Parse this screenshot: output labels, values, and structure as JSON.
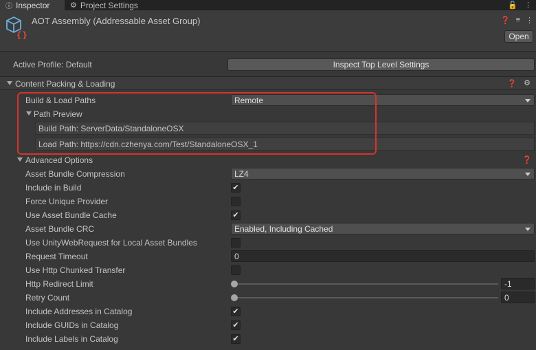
{
  "tabs": [
    {
      "label": "Inspector",
      "icon": "info-icon",
      "active": true
    },
    {
      "label": "Project Settings",
      "icon": "gear-icon",
      "active": false
    }
  ],
  "header": {
    "title": "AOT Assembly (Addressable Asset Group)",
    "open_label": "Open"
  },
  "profile": {
    "label": "Active Profile: Default",
    "button_label": "Inspect Top Level Settings"
  },
  "content_section": {
    "title": "Content Packing & Loading"
  },
  "build_load_paths": {
    "label": "Build & Load Paths",
    "value": "Remote",
    "preview_title": "Path Preview",
    "build_path": "Build Path: ServerData/StandaloneOSX",
    "load_path": "Load Path: https://cdn.czhenya.com/Test/StandaloneOSX_1"
  },
  "advanced": {
    "title": "Advanced Options",
    "rows": {
      "compression": {
        "label": "Asset Bundle Compression",
        "value": "LZ4"
      },
      "include_in_build": {
        "label": "Include in Build",
        "checked": true
      },
      "force_unique": {
        "label": "Force Unique Provider",
        "checked": false
      },
      "bundle_cache": {
        "label": "Use Asset Bundle Cache",
        "checked": true
      },
      "bundle_crc": {
        "label": "Asset Bundle CRC",
        "value": "Enabled, Including Cached"
      },
      "uwr_local": {
        "label": "Use UnityWebRequest for Local Asset Bundles",
        "checked": false
      },
      "request_timeout": {
        "label": "Request Timeout",
        "value": "0"
      },
      "http_chunked": {
        "label": "Use Http Chunked Transfer",
        "checked": false
      },
      "redirect_limit": {
        "label": "Http Redirect Limit",
        "value": "-1"
      },
      "retry_count": {
        "label": "Retry Count",
        "value": "0"
      },
      "include_addresses": {
        "label": "Include Addresses in Catalog",
        "checked": true
      },
      "include_guids": {
        "label": "Include GUIDs in Catalog",
        "checked": true
      },
      "include_labels": {
        "label": "Include Labels in Catalog",
        "checked": true
      }
    }
  },
  "colors": {
    "background": "#383838",
    "highlight": "#d5352b",
    "asset_icon": "#6ab0de",
    "asset_icon_accent": "#e04a3a"
  }
}
